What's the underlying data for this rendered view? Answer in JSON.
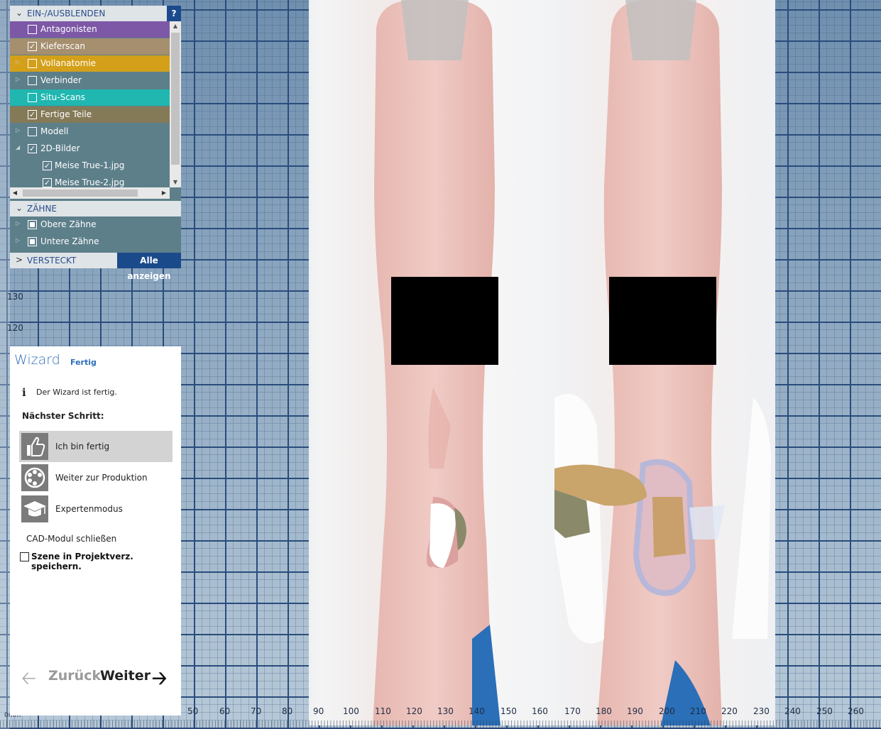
{
  "visibility_panel": {
    "title": "EIN-/AUSBLENDEN",
    "help_label": "?",
    "items": [
      {
        "label": "Antagonisten",
        "checked": false,
        "color": "#7d58a6",
        "expandable": false
      },
      {
        "label": "Kieferscan",
        "checked": true,
        "color": "#a58f6f",
        "expandable": false
      },
      {
        "label": "Vollanatomie",
        "checked": false,
        "color": "#d4a01a",
        "expandable": true
      },
      {
        "label": "Verbinder",
        "checked": false,
        "color": "#5d7f8a",
        "expandable": true
      },
      {
        "label": "Situ-Scans",
        "checked": false,
        "color": "#1fb7b0",
        "expandable": false
      },
      {
        "label": "Fertige Teile",
        "checked": true,
        "color": "#857a57",
        "expandable": false
      },
      {
        "label": "Modell",
        "checked": false,
        "color": "#5d7f8a",
        "expandable": true
      },
      {
        "label": "2D-Bilder",
        "checked": true,
        "color": "#5d7f8a",
        "expandable": true,
        "expanded": true
      },
      {
        "label": "Meise True-1.jpg",
        "checked": true,
        "color": "#5d7f8a",
        "sub": true
      },
      {
        "label": "Meise True-2.jpg",
        "checked": true,
        "color": "#5d7f8a",
        "sub": true
      }
    ]
  },
  "teeth_panel": {
    "title": "ZÄHNE",
    "items": [
      {
        "label": "Obere Zähne",
        "state": "partial"
      },
      {
        "label": "Untere Zähne",
        "state": "partial"
      }
    ]
  },
  "hidden_panel": {
    "title": "VERSTECKT",
    "show_all_label": "Alle anzeigen"
  },
  "wizard": {
    "title": "Wizard",
    "status": "Fertig",
    "info_icon": "info-icon",
    "info_text": "Der Wizard ist fertig.",
    "next_step_label": "Nächster Schritt:",
    "options": [
      {
        "label": "Ich bin fertig",
        "icon": "thumbs-up-icon",
        "active": true
      },
      {
        "label": "Weiter zur Produktion",
        "icon": "production-icon",
        "active": false
      },
      {
        "label": "Expertenmodus",
        "icon": "graduation-cap-icon",
        "active": false
      }
    ],
    "close_label": "CAD-Modul schließen",
    "save_scene_label": "Szene in Projektverz. speichern.",
    "save_scene_checked": false,
    "back_label": "Zurück",
    "next_label": "Weiter"
  },
  "ruler": {
    "left_labels": [
      "130",
      "120"
    ],
    "bottom_labels": [
      "50",
      "60",
      "70",
      "80",
      "90",
      "100",
      "110",
      "120",
      "130",
      "140",
      "150",
      "160",
      "170",
      "180",
      "190",
      "200",
      "210",
      "220",
      "230",
      "240",
      "250",
      "260"
    ],
    "corner_label": "0mm"
  },
  "colors": {
    "grid_line": "#294c7c",
    "panel_bg": "#5d7f8a",
    "accent_blue": "#1b4a8a"
  }
}
